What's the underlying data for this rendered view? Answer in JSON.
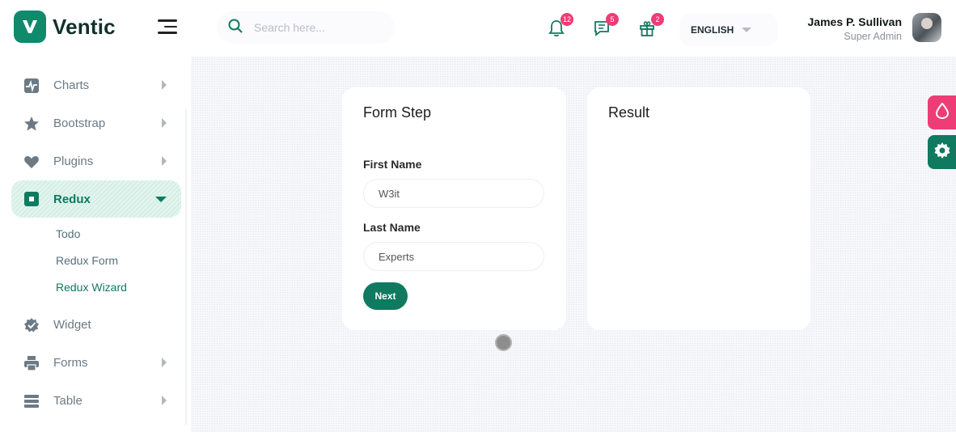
{
  "brand": {
    "name": "Ventic",
    "logo_letter": "V"
  },
  "search": {
    "placeholder": "Search here..."
  },
  "header": {
    "notifications_count": "12",
    "messages_count": "5",
    "gifts_count": "2",
    "language": "ENGLISH",
    "user_name": "James P. Sullivan",
    "user_role": "Super Admin"
  },
  "sidebar": {
    "items": [
      {
        "label": "Charts",
        "icon": "chart-pulse-icon"
      },
      {
        "label": "Bootstrap",
        "icon": "star-icon"
      },
      {
        "label": "Plugins",
        "icon": "heart-icon"
      },
      {
        "label": "Redux",
        "icon": "square-icon"
      },
      {
        "label": "Widget",
        "icon": "widget-badge-icon"
      },
      {
        "label": "Forms",
        "icon": "printer-icon"
      },
      {
        "label": "Table",
        "icon": "table-icon"
      }
    ],
    "redux_sub": [
      "Todo",
      "Redux Form",
      "Redux Wizard"
    ]
  },
  "form_card": {
    "title": "Form Step",
    "first_name_label": "First Name",
    "first_name_value": "W3it",
    "last_name_label": "Last Name",
    "last_name_value": "Experts",
    "next_label": "Next"
  },
  "result_card": {
    "title": "Result"
  },
  "colors": {
    "primary": "#0f7a60",
    "accent": "#ee3c76",
    "sidebar_text": "#6b7a85"
  }
}
